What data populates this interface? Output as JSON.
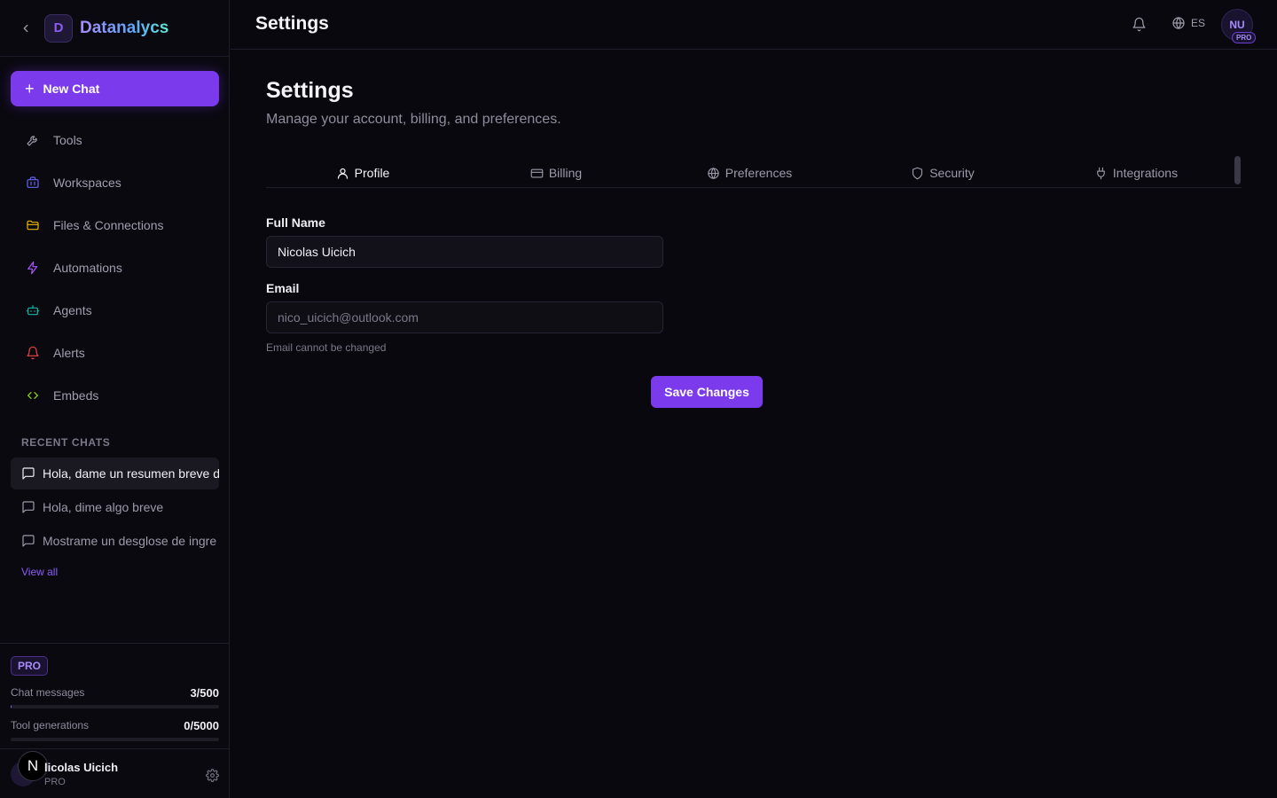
{
  "sidebar": {
    "brand_initial": "D",
    "brand_name": "Datanalycs",
    "new_chat_label": "New Chat",
    "nav": [
      {
        "label": "Tools",
        "icon": "wrench-icon",
        "color": "#9d9aaa"
      },
      {
        "label": "Workspaces",
        "icon": "briefcase-icon",
        "color": "#6366f1"
      },
      {
        "label": "Files & Connections",
        "icon": "folder-icon",
        "color": "#eab308"
      },
      {
        "label": "Automations",
        "icon": "lightning-icon",
        "color": "#a855f7"
      },
      {
        "label": "Agents",
        "icon": "robot-icon",
        "color": "#14b8a6"
      },
      {
        "label": "Alerts",
        "icon": "bell-icon",
        "color": "#ef4444"
      },
      {
        "label": "Embeds",
        "icon": "code-icon",
        "color": "#84cc16"
      }
    ],
    "recent_title": "RECENT CHATS",
    "recent_chats": [
      {
        "label": "Hola, dame un resumen breve d",
        "active": true
      },
      {
        "label": "Hola, dime algo breve",
        "active": false
      },
      {
        "label": "Mostrame un desglose de ingre",
        "active": false
      }
    ],
    "view_all_label": "View all",
    "plan_badge": "PRO",
    "usage": [
      {
        "label": "Chat messages",
        "value": "3/500",
        "fraction": 0.006
      },
      {
        "label": "Tool generations",
        "value": "0/5000",
        "fraction": 0
      }
    ],
    "user": {
      "badge": "N",
      "name": "licolas Uicich",
      "plan": "PRO"
    }
  },
  "header": {
    "title": "Settings",
    "language": "ES",
    "avatar_initials": "NU",
    "avatar_badge": "PRO"
  },
  "main": {
    "title": "Settings",
    "subtitle": "Manage your account, billing, and preferences.",
    "tabs": [
      {
        "label": "Profile",
        "icon": "user-icon",
        "active": true
      },
      {
        "label": "Billing",
        "icon": "credit-card-icon",
        "active": false
      },
      {
        "label": "Preferences",
        "icon": "globe-icon",
        "active": false
      },
      {
        "label": "Security",
        "icon": "shield-icon",
        "active": false
      },
      {
        "label": "Integrations",
        "icon": "plug-icon",
        "active": false
      }
    ],
    "form": {
      "full_name_label": "Full Name",
      "full_name_value": "Nicolas Uicich",
      "email_label": "Email",
      "email_value": "nico_uicich@outlook.com",
      "email_hint": "Email cannot be changed",
      "save_label": "Save Changes"
    }
  },
  "colors": {
    "accent": "#7c3aed",
    "background": "#09080e"
  }
}
